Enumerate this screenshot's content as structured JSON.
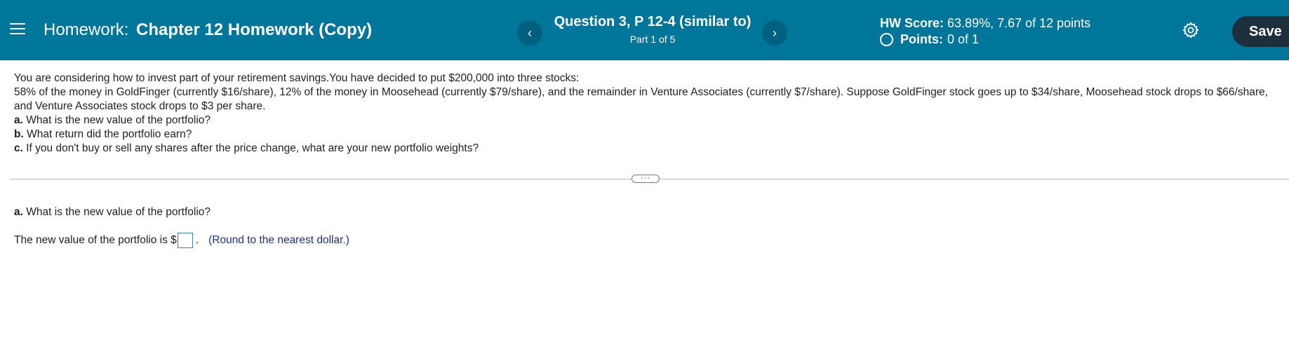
{
  "header": {
    "homework_prefix": "Homework:",
    "homework_name": "Chapter 12 Homework (Copy)",
    "question_title": "Question 3, P 12-4 (similar to)",
    "question_part": "Part 1 of 5",
    "prev_label": "‹",
    "next_label": "›",
    "score_label": "HW Score:",
    "score_value": "63.89%, 7.67 of 12 points",
    "points_label": "Points:",
    "points_value": "0 of 1",
    "save_label": "Save"
  },
  "question": {
    "intro": "You are considering how to invest part of your retirement savings.You have decided to put $200,000 into three stocks:",
    "details": "58% of the money in GoldFinger (currently $16/share), 12% of the money in Moosehead (currently $79/share), and the remainder in Venture Associates (currently $7/share). Suppose GoldFinger stock goes up to $34/share, Moosehead stock drops to $66/share, and Venture Associates stock drops to $3 per share.",
    "items": [
      {
        "letter": "a.",
        "text": "What is the new value of the portfolio?"
      },
      {
        "letter": "b.",
        "text": "What return did the portfolio earn?"
      },
      {
        "letter": "c.",
        "text": "If you don't buy or sell any shares after the price change, what are your new portfolio weights?"
      }
    ]
  },
  "divider": {
    "handle_label": "···"
  },
  "answer": {
    "question_letter": "a.",
    "question_text": "What is the new value of the portfolio?",
    "prefix": "The new value of the portfolio is $",
    "input_value": "",
    "suffix": ".",
    "hint": "(Round to the nearest dollar.)"
  },
  "icons": [
    "menu-icon",
    "chevron-left-icon",
    "chevron-right-icon",
    "circle-icon",
    "gear-icon"
  ],
  "colors": {
    "header_bg": "#00769b",
    "save_bg": "#1d2f3c",
    "hint_color": "#1f2e9e",
    "input_border": "#4a74c9"
  }
}
